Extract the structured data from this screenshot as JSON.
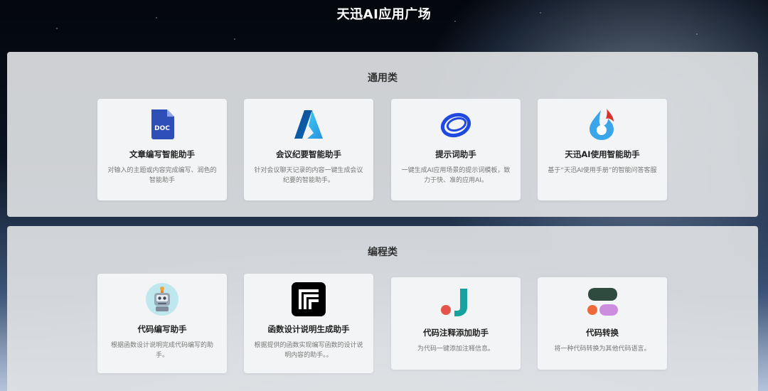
{
  "page": {
    "title": "天迅AI应用广场"
  },
  "sections": [
    {
      "title": "通用类",
      "cards": [
        {
          "icon": "doc-file-icon",
          "icon_text": "DOC",
          "name": "文章编写智能助手",
          "desc": "对输入的主题或内容完成编写、润色的智能助手"
        },
        {
          "icon": "azure-logo-icon",
          "name": "会议纪要智能助手",
          "desc": "针对会议聊天记录的内容一键生成会议纪要的智能助手。"
        },
        {
          "icon": "blue-ring-icon",
          "name": "提示词助手",
          "desc": "一键生成AI应用场景的提示词模板，致力于快、准的应用AI。"
        },
        {
          "icon": "flame-drop-icon",
          "name": "天迅AI使用智能助手",
          "desc": "基于“天迅AI使用手册”的智能问答客服"
        }
      ]
    },
    {
      "title": "编程类",
      "cards": [
        {
          "icon": "robot-icon",
          "name": "代码编写助手",
          "desc": "根据函数设计说明完成代码编写的助手。"
        },
        {
          "icon": "frame-logo-icon",
          "name": "函数设计说明生成助手",
          "desc": "根据提供的函数实现编写函数的设计说明内容的助手。。"
        },
        {
          "icon": "dot-hook-icon",
          "name": "代码注释添加助手",
          "desc": "为代码一键添加注释信息。"
        },
        {
          "icon": "blob-shapes-icon",
          "name": "代码转换",
          "desc": "将一种代码转换为其他代码语言。"
        }
      ]
    }
  ],
  "colors": {
    "doc_blue": "#2e4fb8",
    "azure_blue": "#1a73d9",
    "ring_blue": "#1f49e0",
    "flame_red": "#d8322c",
    "drop_blue": "#3aa5e8",
    "hook_teal": "#15a2a0",
    "dot_red": "#e5534b",
    "blob_dark": "#2f4a3e",
    "blob_orange": "#ef6a3a",
    "blob_purple": "#cc8de0"
  }
}
